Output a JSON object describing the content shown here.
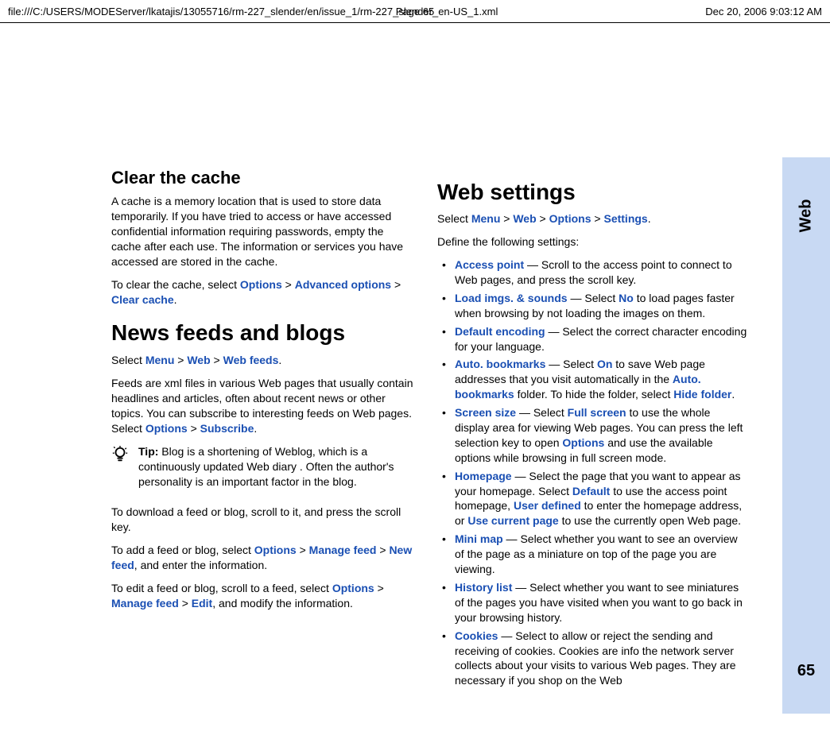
{
  "header": {
    "path": "file:///C:/USERS/MODEServer/lkatajis/13055716/rm-227_slender/en/issue_1/rm-227_slender_en-US_1.xml",
    "page": "Page 65",
    "timestamp": "Dec 20, 2006 9:03:12 AM"
  },
  "side": {
    "section": "Web",
    "page_number": "65"
  },
  "left": {
    "h_clear": "Clear the cache",
    "clear_p": "A cache is a memory location that is used to store data temporarily. If you have tried to access or have accessed confidential information requiring passwords, empty the cache after each use. The information or services you have accessed are stored in the cache.",
    "clear_lead": "To clear the cache, select ",
    "opt": "Options",
    "gt": " > ",
    "adv": "Advanced options",
    "clearcache": "Clear cache",
    "period": ".",
    "h_news": "News feeds and blogs",
    "sel_lead": "Select ",
    "menu": "Menu",
    "web": "Web",
    "webfeeds": "Web feeds",
    "feeds_p_lead": "Feeds are xml files in various Web pages that usually contain headlines and articles, often about recent news or other topics. You can subscribe to interesting feeds on Web pages. Select ",
    "subscribe": "Subscribe",
    "tip_label": "Tip:",
    "tip_body": " Blog is a shortening of Weblog, which is a continuously updated Web diary . Often the author's personality is an important factor in the blog.",
    "dl_p": "To download a feed or blog, scroll to it, and press the scroll key.",
    "add_lead": "To add a feed or blog, select ",
    "manage_feed": "Manage feed",
    "new_feed": "New feed",
    "add_tail": ", and enter the information.",
    "edit_lead": "To edit a feed or blog, scroll to a feed, select ",
    "edit": "Edit",
    "edit_tail": ", and modify the information."
  },
  "right": {
    "h_ws": "Web settings",
    "ws_lead": "Select ",
    "menu": "Menu",
    "web": "Web",
    "options": "Options",
    "settings": "Settings",
    "gt": " > ",
    "period": ".",
    "define": "Define the following settings:",
    "items": {
      "ap_k": "Access point",
      "ap_t": " — Scroll to the access point to connect to Web pages, and press the scroll key.",
      "li_k": "Load imgs. & sounds",
      "li_t1": " — Select ",
      "no": "No",
      "li_t2": " to load pages faster when browsing by not loading the images on them.",
      "de_k": "Default encoding",
      "de_t": " — Select the correct character encoding for your language.",
      "ab_k": "Auto. bookmarks",
      "ab_t1": " — Select ",
      "on": "On",
      "ab_t2": " to save Web page addresses that you visit automatically in the ",
      "ab_folder": "Auto. bookmarks",
      "ab_t3": " folder. To hide the folder, select ",
      "hide": "Hide folder",
      "ss_k": "Screen size",
      "ss_t1": " — Select ",
      "full": "Full screen",
      "ss_t2": " to use the whole display area for viewing Web pages. You can press the left selection key to open ",
      "ss_opt": "Options",
      "ss_t3": " and use the available options while browsing in full screen mode.",
      "hp_k": "Homepage",
      "hp_t1": " — Select the page that you want to appear as your homepage. Select ",
      "default": "Default",
      "hp_t2": " to use the access point homepage, ",
      "userdef": "User defined",
      "hp_t3": " to enter the homepage address, or ",
      "usecur": "Use current page",
      "hp_t4": " to use the currently open Web page.",
      "mm_k": "Mini map",
      "mm_t": " — Select whether you want to see an overview of the page as a miniature on top of the page you are viewing.",
      "hl_k": "History list",
      "hl_t": " — Select whether you want to see miniatures of the pages you have visited when you want to go back in your browsing history.",
      "ck_k": "Cookies",
      "ck_t": " — Select to allow or reject the sending and receiving of cookies. Cookies are info the network server collects about your visits to various Web pages. They are necessary if you shop on the Web"
    }
  }
}
